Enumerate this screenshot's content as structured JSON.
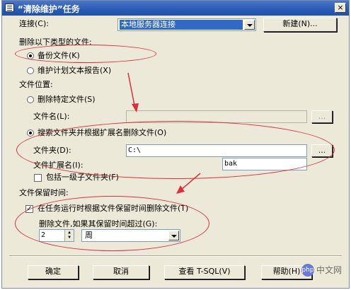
{
  "window": {
    "title": "“清除维护”任务",
    "close_glyph": "×"
  },
  "connection": {
    "label": "连接(C):",
    "value": "本地服务器连接",
    "new_button": "新建(N)..."
  },
  "delete_type": {
    "group_label": "删除以下类型的文件:",
    "backup_option": "备份文件(K)",
    "report_option": "维护计划文本报告(X)"
  },
  "file_location": {
    "group_label": "文件位置:",
    "specific_option": "删除特定文件(S)",
    "filename_label": "文件名(L):",
    "filename_value": "",
    "search_option": "搜索文件夹并根据扩展名删除文件(O)",
    "folder_label": "文件夹(D):",
    "folder_value": "C:\\",
    "extension_label": "文件扩展名(I):",
    "extension_value": "bak",
    "subfolder_option": "包括一级子文件夹(F)",
    "browse_label": "..."
  },
  "retention": {
    "group_label": "文件保留时间:",
    "age_option": "在任务运行时根据文件保留时间删除文件(T)",
    "age_label": "删除文件,如果其保留时间超过(G):",
    "number_value": "2",
    "unit_value": "周"
  },
  "footer": {
    "ok": "确定",
    "cancel": "取消",
    "view_tsql": "查看 T-SQL(V)",
    "help": "帮助(H)"
  },
  "watermark": {
    "logo": "php",
    "text": "中文网"
  },
  "colors": {
    "annotation": "#d9313a",
    "selection": "#316ac5",
    "titlebar": "#2a5bb4"
  }
}
